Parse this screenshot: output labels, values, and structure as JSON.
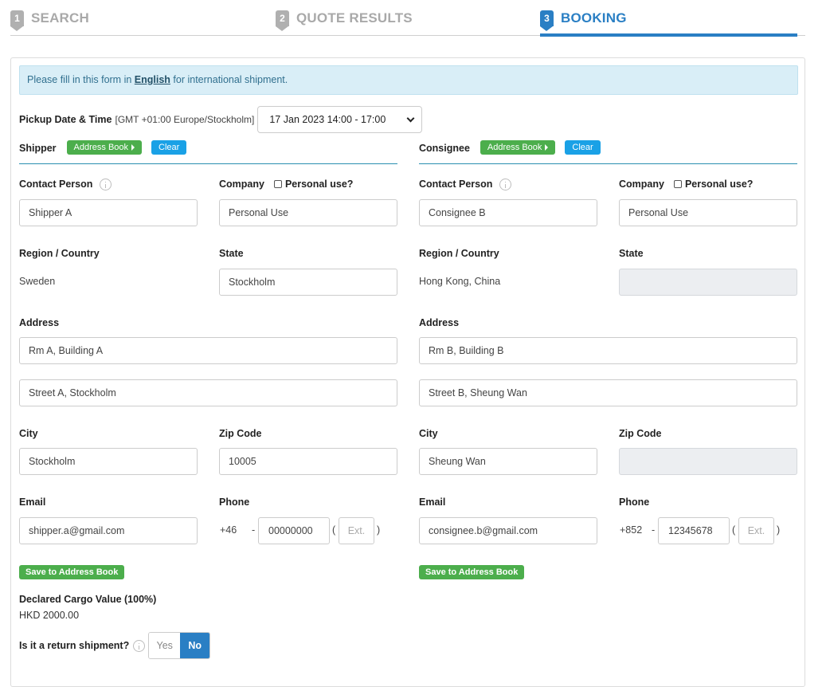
{
  "steps": [
    {
      "num": "1",
      "label": "SEARCH"
    },
    {
      "num": "2",
      "label": "QUOTE RESULTS"
    },
    {
      "num": "3",
      "label": "BOOKING"
    }
  ],
  "notice": {
    "prefix": "Please fill in this form in ",
    "emphasis": "English",
    "suffix": " for international shipment."
  },
  "pickup": {
    "label": "Pickup Date & Time",
    "timezone": "[GMT +01:00 Europe/Stockholm]",
    "selected": "17 Jan 2023 14:00 - 17:00"
  },
  "labels": {
    "contact_person": "Contact Person",
    "company": "Company",
    "personal_use": "Personal use?",
    "region_country": "Region / Country",
    "state": "State",
    "address": "Address",
    "city": "City",
    "zip_code": "Zip Code",
    "email": "Email",
    "phone": "Phone",
    "address_book": "Address Book",
    "clear": "Clear",
    "save_to_address_book": "Save to Address Book",
    "ext_placeholder": "Ext."
  },
  "shipper": {
    "title": "Shipper",
    "contact_person": "Shipper A",
    "company": "Personal Use",
    "region_country": "Sweden",
    "state": "Stockholm",
    "address1": "Rm A, Building A",
    "address2": "Street A, Stockholm",
    "city": "Stockholm",
    "zip_code": "10005",
    "email": "shipper.a@gmail.com",
    "phone_code": "+46",
    "phone_number": "00000000",
    "phone_ext": ""
  },
  "consignee": {
    "title": "Consignee",
    "contact_person": "Consignee B",
    "company": "Personal Use",
    "region_country": "Hong Kong, China",
    "state": "",
    "address1": "Rm B, Building B",
    "address2": "Street B, Sheung Wan",
    "city": "Sheung Wan",
    "zip_code": "",
    "email": "consignee.b@gmail.com",
    "phone_code": "+852",
    "phone_number": "12345678",
    "phone_ext": ""
  },
  "cargo": {
    "label": "Declared Cargo Value (100%)",
    "value": "HKD 2000.00"
  },
  "return_shipment": {
    "label": "Is it a return shipment?",
    "yes": "Yes",
    "no": "No",
    "selected": "No"
  },
  "colors": {
    "primary": "#2a7fc4",
    "green": "#4cae4c",
    "clear_blue": "#1aa1e6",
    "notice_bg": "#d9eef7"
  }
}
